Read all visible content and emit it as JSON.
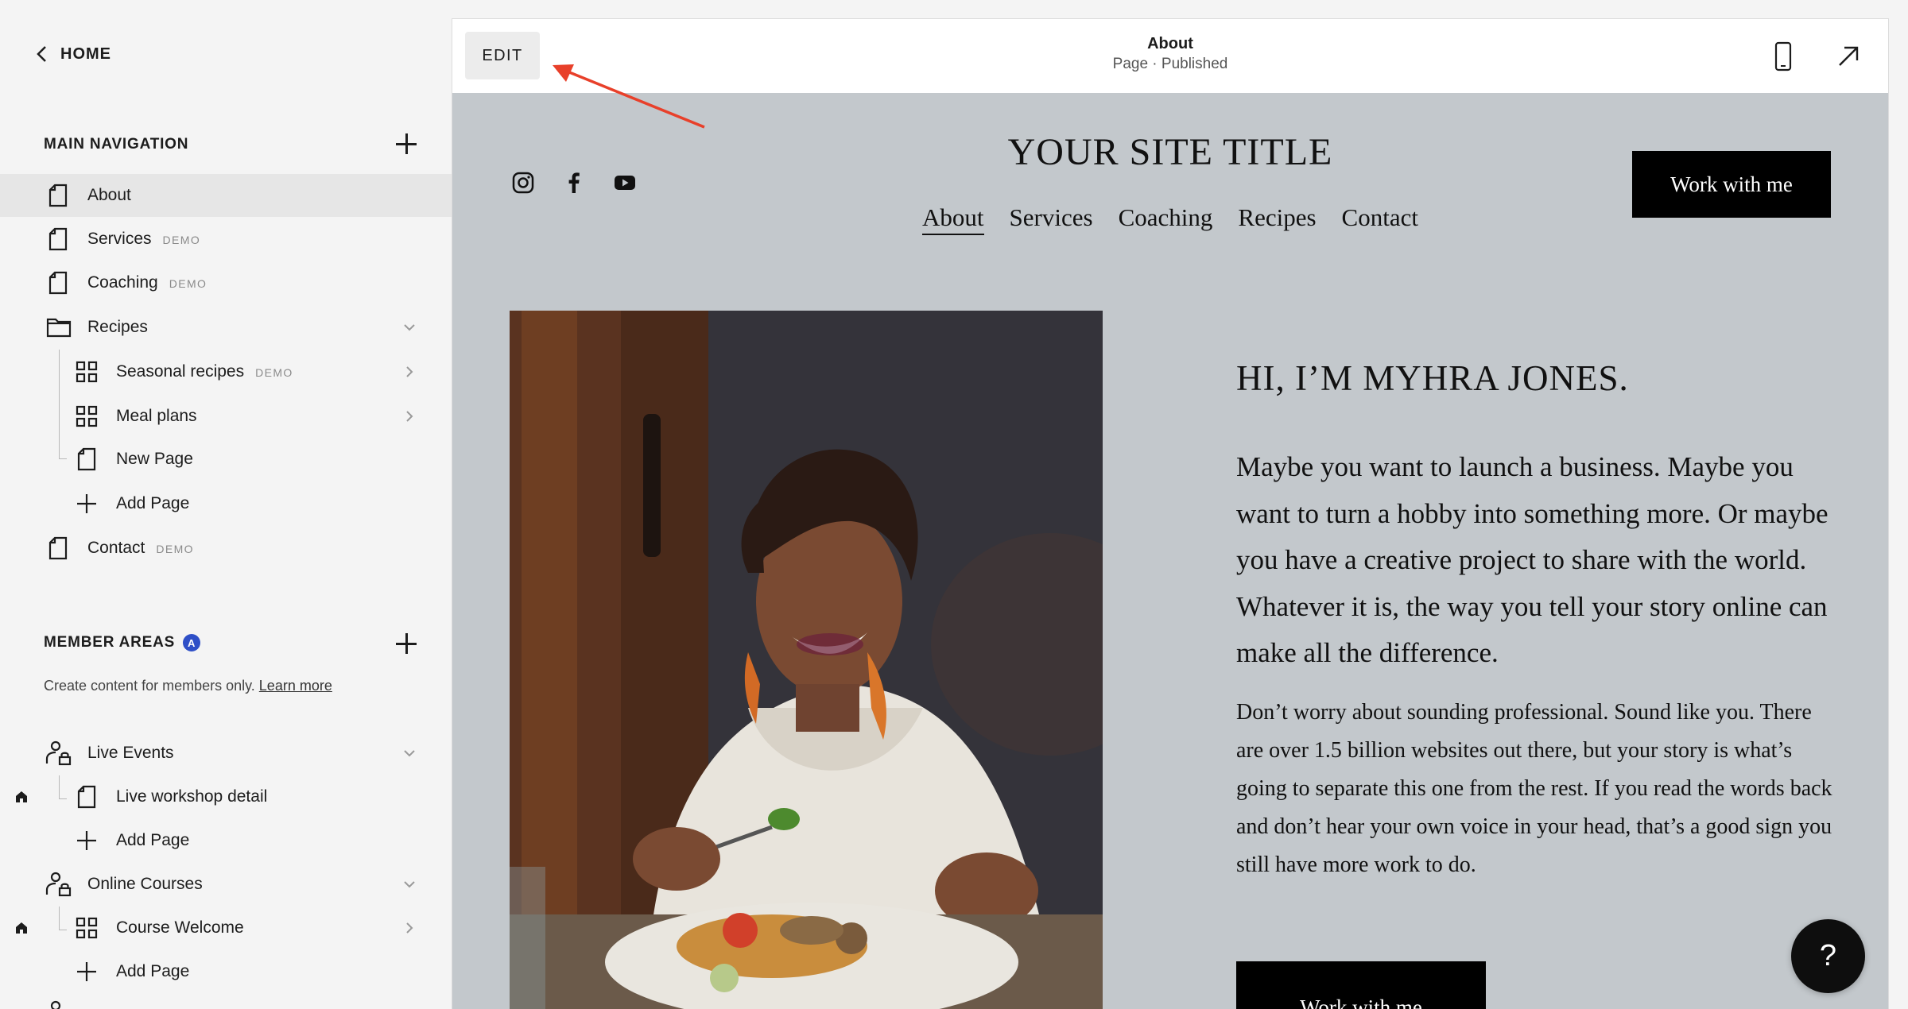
{
  "sidebar": {
    "home_label": "HOME",
    "main_nav_heading": "MAIN NAVIGATION",
    "main_items": [
      {
        "label": "About",
        "demo": ""
      },
      {
        "label": "Services",
        "demo": "DEMO"
      },
      {
        "label": "Coaching",
        "demo": "DEMO"
      },
      {
        "label": "Recipes",
        "demo": ""
      },
      {
        "label": "Seasonal recipes",
        "demo": "DEMO"
      },
      {
        "label": "Meal plans",
        "demo": ""
      },
      {
        "label": "New Page",
        "demo": ""
      },
      {
        "label": "Add Page",
        "demo": ""
      },
      {
        "label": "Contact",
        "demo": "DEMO"
      }
    ],
    "member_heading": "MEMBER AREAS",
    "member_badge": "A",
    "member_desc": "Create content for members only.",
    "member_learn_more": "Learn more",
    "member_items": [
      {
        "label": "Live Events"
      },
      {
        "label": "Live workshop detail"
      },
      {
        "label": "Add Page"
      },
      {
        "label": "Online Courses"
      },
      {
        "label": "Course Welcome"
      },
      {
        "label": "Add Page"
      }
    ]
  },
  "topbar": {
    "edit_label": "EDIT",
    "page_title": "About",
    "page_status": "Page · Published",
    "annotation_color": "#e8402a"
  },
  "site": {
    "title": "YOUR SITE TITLE",
    "nav": [
      "About",
      "Services",
      "Coaching",
      "Recipes",
      "Contact"
    ],
    "cta_label": "Work with me",
    "heading": "HI, I’M MYHRA JONES.",
    "paragraph1": "Maybe you want to launch a business. Maybe you want to turn a hobby into something more. Or maybe you have a creative project to share with the world. Whatever it is, the way you tell your story online can make all the difference.",
    "paragraph2": "Don’t worry about sounding professional. Sound like you. There are over 1.5 billion websites out there, but your story is what’s going to separate this one from the rest. If you read the words back and don’t hear your own voice in your head, that’s a good sign you still have more work to do.",
    "cta_bottom_label": "Work with me",
    "social_icons": [
      "instagram-icon",
      "facebook-icon",
      "youtube-icon"
    ]
  },
  "help": {
    "label": "?"
  }
}
